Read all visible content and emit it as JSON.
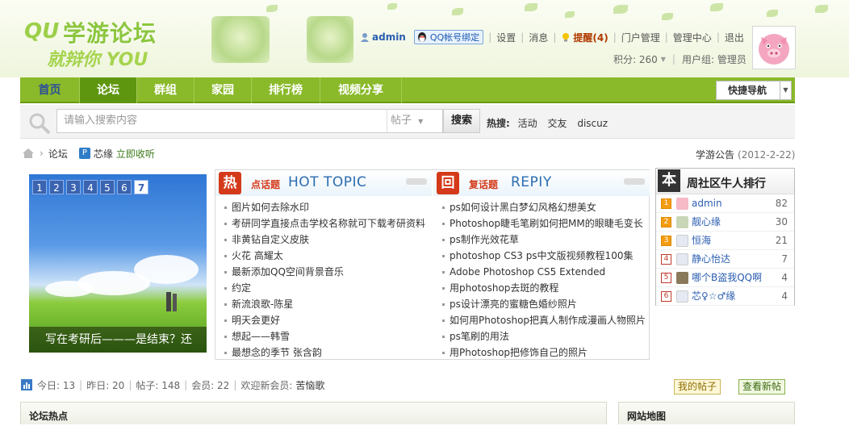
{
  "header": {
    "logo": {
      "line1": "学游论坛",
      "line2": "QU",
      "line3": "就辩你 YOU"
    },
    "user": {
      "name": "admin",
      "qq_bind": "QQ帐号绑定",
      "links": [
        "设置",
        "消息"
      ],
      "remind": "提醒(4)",
      "links2": [
        "门户管理",
        "管理中心",
        "退出"
      ],
      "points": "积分: 260",
      "group": "用户组: 管理员"
    }
  },
  "nav": {
    "items": [
      "首页",
      "论坛",
      "群组",
      "家园",
      "排行榜",
      "视频分享"
    ],
    "active_index": 1,
    "quick_nav": "快捷导航"
  },
  "search": {
    "placeholder": "请输入搜索内容",
    "type": "帖子",
    "button": "搜索",
    "hot_label": "热搜:",
    "hot_terms": [
      "活动",
      "交友",
      "discuz"
    ]
  },
  "breadcrumb": {
    "forum": "论坛",
    "site": "芯缘",
    "collect": "立即收听"
  },
  "announcement": {
    "label": "学游公告",
    "date": "(2012-2-22)"
  },
  "slider": {
    "pages": [
      "1",
      "2",
      "3",
      "4",
      "5",
      "6",
      "7"
    ],
    "current": 7,
    "caption": "写在考研后———是结束？还"
  },
  "hot_topics": {
    "badge": "热",
    "label": "点话题",
    "en": "HOT TOPIC",
    "items": [
      "图片如何去除水印",
      "考研同学直接点击学校名称就可下载考研资料",
      "非黄钻自定义皮肤",
      "火花 高耀太",
      "最新添加QQ空间背景音乐",
      "约定",
      "新流浪歌-陈星",
      "明天会更好",
      "想起——韩雪",
      "最想念的季节 张含韵"
    ]
  },
  "replies": {
    "badge": "回",
    "label": "复话题",
    "en": "REPIY",
    "items": [
      "ps如何设计黑白梦幻风格幻想美女",
      "Photoshop睫毛笔刷如何把MM的眼睫毛变长",
      "ps制作光效花草",
      "photoshop CS3 ps中文版视频教程100集",
      "Adobe Photoshop CS5 Extended",
      "用photoshop去斑的教程",
      "ps设计漂亮的蜜糖色婚纱照片",
      "如何用Photoshop把真人制作成漫画人物照片",
      "ps笔刷的用法",
      "用Photoshop把修饰自己的照片"
    ]
  },
  "ranking": {
    "badge": "本",
    "title": "周社区牛人排行",
    "rows": [
      {
        "rank": "1",
        "name": "admin",
        "count": "82"
      },
      {
        "rank": "2",
        "name": "靓心缘",
        "count": "30"
      },
      {
        "rank": "3",
        "name": "恒海",
        "count": "21"
      },
      {
        "rank": "4",
        "name": "静心怡达",
        "count": "7"
      },
      {
        "rank": "5",
        "name": "哪个B盗我QQ啊",
        "count": "4"
      },
      {
        "rank": "6",
        "name": "芯♀☆♂缘",
        "count": "4"
      }
    ]
  },
  "stats": {
    "today": "今日: 13",
    "yesterday": "昨日: 20",
    "posts": "帖子: 148",
    "members": "会员: 22",
    "welcome": "欢迎新会员:",
    "newest": "苦恼歌"
  },
  "actions": {
    "my_posts": "我的帖子",
    "new_posts": "查看新帖"
  },
  "panels": {
    "left": "论坛热点",
    "right": "网站地图"
  },
  "colors": {
    "nav_green": "#8ab92a",
    "active_green": "#5f9610",
    "hot_red": "#d43a1a",
    "link_blue": "#2a5db0"
  }
}
